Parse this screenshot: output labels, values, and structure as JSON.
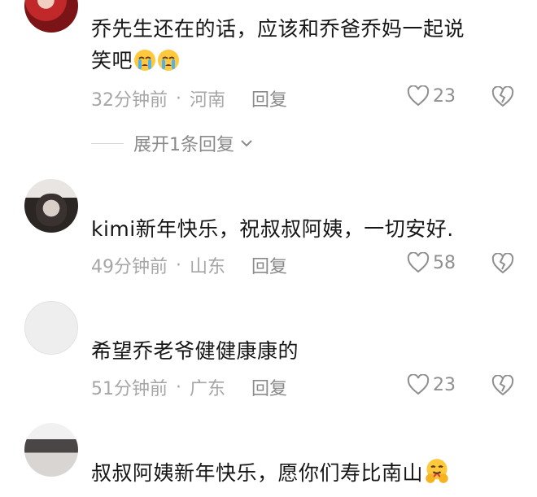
{
  "comments": [
    {
      "text_lines": [
        "乔先生还在的话，应该和乔爸乔妈一起说",
        "笑吧"
      ],
      "time": "32分钟前",
      "location": "河南",
      "reply_label": "回复",
      "likes": "23",
      "expand_label": "展开1条回复"
    },
    {
      "text": "kimi新年快乐，祝叔叔阿姨，一切安好.",
      "time": "49分钟前",
      "location": "山东",
      "reply_label": "回复",
      "likes": "58"
    },
    {
      "text": "希望乔老爷健健康康的",
      "time": "51分钟前",
      "location": "广东",
      "reply_label": "回复",
      "likes": "23"
    },
    {
      "text": "叔叔阿姨新年快乐，愿你们寿比南山"
    }
  ],
  "icons": {
    "like": "heart-outline-icon",
    "dislike": "broken-heart-icon",
    "expand": "chevron-down-icon",
    "crying_emoji": "crying-face-emoji",
    "hug_emoji": "hugging-face-emoji"
  },
  "colors": {
    "text": "#161616",
    "meta": "#a6a6a6",
    "icon": "#8f8f8f"
  }
}
